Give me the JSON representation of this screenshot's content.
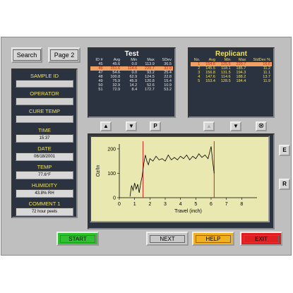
{
  "toolbar": {
    "search_label": "Search",
    "page2_label": "Page 2"
  },
  "sidebar": {
    "sample_id_label": "SAMPLE ID",
    "operator_label": "OPERATOR",
    "cure_temp_label": "CURE TEMP",
    "time_label": "TIME",
    "time_value": "15:37",
    "date_label": "DATE",
    "date_value": "06/18/2001",
    "temp_label": "TEMP",
    "temp_value": "77.6°F",
    "humidity_label": "HUMIDITY",
    "humidity_value": "43.8% RH",
    "comment_label": "COMMENT 1",
    "comment_value": "72 hour peels"
  },
  "test": {
    "title": "Test",
    "headers": [
      "ID #",
      "Avg",
      "Min",
      "Max",
      "SDev"
    ],
    "rows": [
      [
        "45",
        "45.6",
        "0.0",
        "113.9",
        "36.5"
      ],
      [
        "46",
        "151.6",
        "114.6",
        "220.7",
        "32.0"
      ],
      [
        "47",
        "54.6",
        "0.0",
        "93.2",
        "25.4"
      ],
      [
        "48",
        "100.8",
        "62.9",
        "124.5",
        "22.8"
      ],
      [
        "49",
        "75.9",
        "45.9",
        "120.8",
        "15.4"
      ],
      [
        "50",
        "32.9",
        "14.2",
        "52.6",
        "10.9"
      ],
      [
        "51",
        "72.9",
        "8.4",
        "172.7",
        "53.2"
      ]
    ],
    "selected_index": 1
  },
  "replicant": {
    "title": "Replicant",
    "headers": [
      "No.",
      "Avg",
      "Min",
      "Max",
      "StdDev %"
    ],
    "rows": [
      [
        "1",
        "154.6",
        "125.6",
        "220.7",
        "16.6"
      ],
      [
        "2",
        "145.5",
        "118.1",
        "185.7",
        "11.2"
      ],
      [
        "3",
        "156.8",
        "131.5",
        "194.3",
        "11.1"
      ],
      [
        "4",
        "147.6",
        "114.6",
        "188.2",
        "13.7"
      ],
      [
        "5",
        "153.4",
        "128.5",
        "184.4",
        "11.9"
      ]
    ],
    "selected_index": 0
  },
  "controls": {
    "up_icon": "▲",
    "down_icon": "▼",
    "p_label": "P",
    "clear_icon": "⊗",
    "e_label": "E",
    "r_label": "R"
  },
  "bottom": {
    "start_label": "START",
    "next_label": "NEXT",
    "help_label": "HELP",
    "exit_label": "EXIT"
  },
  "colors": {
    "start": "#30c030",
    "next": "#c8c8c8",
    "help": "#f0b020",
    "exit": "#e02020",
    "plot_line": "#000000",
    "cursor": "#d02020"
  },
  "chart_data": {
    "type": "line",
    "xlabel": "Travel (inch)",
    "ylabel": "Oz/In",
    "xlim": [
      0,
      9
    ],
    "ylim": [
      0,
      220
    ],
    "xticks": [
      "0",
      "1",
      "2",
      "3",
      "4",
      "5",
      "6",
      "7",
      "8"
    ],
    "yticks": [
      "0",
      "100",
      "200"
    ],
    "cursors": [
      1.55,
      6.2
    ],
    "series": [
      {
        "x": [
          0.7,
          0.8,
          0.9,
          1.0,
          1.1,
          1.2,
          1.3,
          1.4,
          1.5,
          1.6,
          1.7,
          1.8,
          1.9,
          2.0,
          2.2,
          2.4,
          2.6,
          2.8,
          3.0,
          3.2,
          3.4,
          3.6,
          3.8,
          4.0,
          4.2,
          4.4,
          4.6,
          4.8,
          5.0,
          5.2,
          5.4,
          5.6,
          5.8,
          6.0,
          6.1,
          6.2
        ],
        "y": [
          5,
          50,
          30,
          60,
          35,
          55,
          20,
          60,
          90,
          140,
          175,
          150,
          135,
          160,
          150,
          170,
          155,
          160,
          150,
          175,
          155,
          165,
          155,
          170,
          160,
          175,
          155,
          170,
          160,
          180,
          165,
          175,
          160,
          210,
          150,
          100
        ]
      }
    ]
  }
}
